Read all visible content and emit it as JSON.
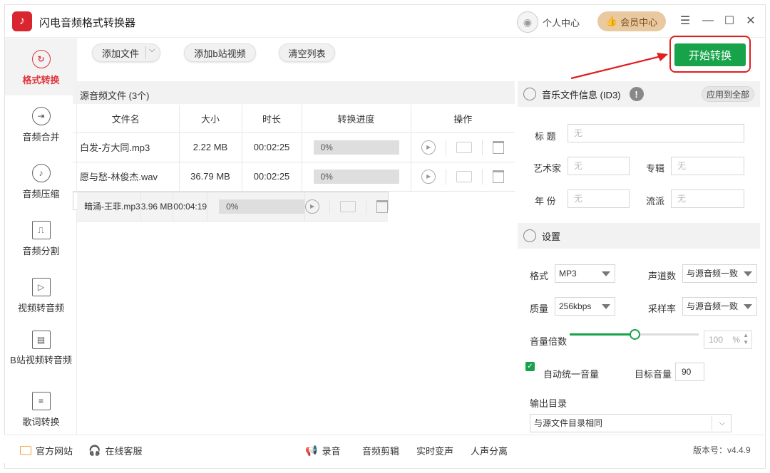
{
  "app": {
    "title": "闪电音频格式转换器",
    "logo_icon": "♪"
  },
  "header": {
    "user_center": "个人中心",
    "vip_center": "会员中心"
  },
  "sidebar": {
    "items": [
      {
        "label": "格式转换",
        "icon": "↻",
        "active": true
      },
      {
        "label": "音频合并",
        "icon": "⇥"
      },
      {
        "label": "音频压缩",
        "icon": "♪"
      },
      {
        "label": "音频分割",
        "icon": "⎍"
      },
      {
        "label": "视频转音频",
        "icon": "▷"
      },
      {
        "label": "B站视频转音频",
        "icon": "▤"
      },
      {
        "label": "歌词转换",
        "icon": "≡"
      }
    ]
  },
  "toolbar": {
    "add_file": "添加文件",
    "add_bilibili": "添加b站视频",
    "clear_list": "清空列表",
    "start": "开始转换"
  },
  "files": {
    "header": "源音频文件 (3个)",
    "columns": [
      "文件名",
      "大小",
      "时长",
      "转换进度",
      "操作"
    ],
    "rows": [
      {
        "name": "白发-方大同.mp3",
        "size": "2.22 MB",
        "duration": "00:02:25",
        "progress": "0%"
      },
      {
        "name": "愿与愁-林俊杰.wav",
        "size": "36.79 MB",
        "duration": "00:02:25",
        "progress": "0%"
      },
      {
        "name": "暗涌-王菲.mp3",
        "size": "3.96 MB",
        "duration": "00:04:19",
        "progress": "0%"
      }
    ]
  },
  "id3": {
    "title": "音乐文件信息 (ID3)",
    "apply_all": "应用到全部",
    "fields": {
      "title_label": "标 题",
      "title_value": "无",
      "artist_label": "艺术家",
      "artist_value": "无",
      "album_label": "专辑",
      "album_value": "无",
      "year_label": "年 份",
      "year_value": "无",
      "genre_label": "流派",
      "genre_value": "无"
    }
  },
  "settings": {
    "title": "设置",
    "format_label": "格式",
    "format_value": "MP3",
    "channels_label": "声道数",
    "channels_value": "与源音频一致",
    "quality_label": "质量",
    "quality_value": "256kbps",
    "samplerate_label": "采样率",
    "samplerate_value": "与源音频一致",
    "volume_label": "音量倍数",
    "volume_value": "100",
    "volume_unit": "%",
    "volume_level": 0.5,
    "auto_volume_label": "自动统一音量",
    "auto_volume_checked": true,
    "target_volume_label": "目标音量",
    "target_volume_value": "90",
    "output_dir_label": "输出目录",
    "output_dir_value": "与源文件目录相同"
  },
  "statusbar": {
    "website": "官方网站",
    "support": "在线客服",
    "record": "录音",
    "edit": "音频剪辑",
    "realtime_voice": "实时变声",
    "vocal_separate": "人声分离",
    "version": "版本号：v4.4.9"
  },
  "colors": {
    "accent": "#17a34a",
    "brand": "#e0343c",
    "highlight": "#e11e1e"
  }
}
